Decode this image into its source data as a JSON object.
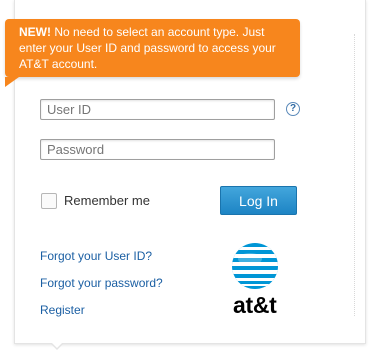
{
  "tooltip": {
    "bold": "NEW!",
    "text": " No need to select an account type. Just enter your User ID and password to access your AT&T account."
  },
  "form": {
    "userid_placeholder": "User ID",
    "password_placeholder": "Password",
    "remember_label": "Remember me",
    "login_label": "Log In",
    "help_glyph": "?"
  },
  "links": {
    "forgot_userid": "Forgot your User ID?",
    "forgot_password": "Forgot your password?",
    "register": "Register"
  },
  "logo": {
    "text": "at&t",
    "icon": "att-globe-icon"
  },
  "colors": {
    "tooltip": "#f7861d",
    "button": "#1d84c4",
    "link": "#1b5fa3"
  }
}
